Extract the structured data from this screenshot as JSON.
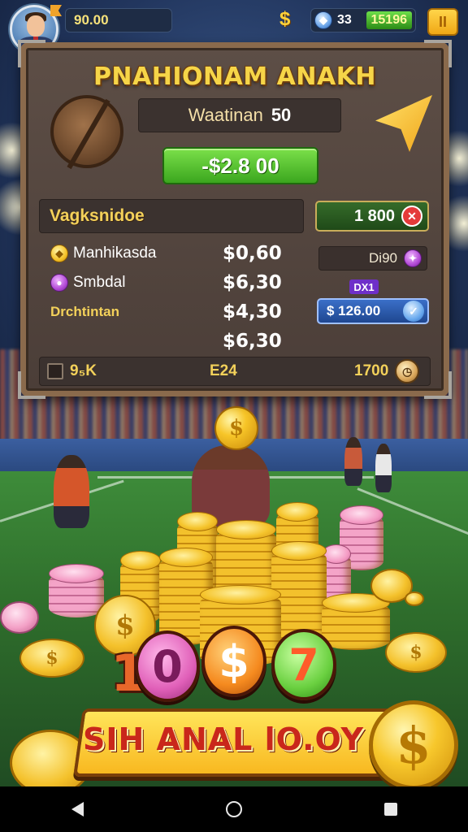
{
  "top_bar": {
    "balance": "90.00",
    "stat_value": "33",
    "score_value": "15196",
    "pause_label": "II"
  },
  "panel": {
    "title": "PNAHIONAM ANAKH",
    "subtitle_label": "Waatinan",
    "subtitle_value": "50",
    "primary_button": "-$2.8 00",
    "section_heading": "Vagksnidoe",
    "section_badge_value": "1 800",
    "rows": [
      {
        "label": "Manhikasda",
        "amount": "$0,60",
        "icon": "gold-coin-icon"
      },
      {
        "label": "Smbdal",
        "amount": "$6,30",
        "icon": "purple-gem-icon"
      },
      {
        "label": "Drchtintan",
        "amount": "$4,30",
        "icon": ""
      },
      {
        "label": "",
        "amount": "$6,30",
        "icon": ""
      }
    ],
    "side_pill_value": "Di90",
    "purple_tag": "DX1",
    "blue_pill_value": "$ 126.00",
    "footer": {
      "left_value": "9₅K",
      "center_value": "E24",
      "right_value": "1700"
    }
  },
  "scene": {
    "token_1": "1",
    "token_0": "0",
    "token_dollar": "$",
    "token_7": "7"
  },
  "banner": {
    "text": "SIH ANAL lO.OY"
  },
  "colors": {
    "accent_gold": "#f6d548",
    "panel_brown": "#5d4e46",
    "button_green": "#3ba61e",
    "banner_red": "#c9271b"
  }
}
